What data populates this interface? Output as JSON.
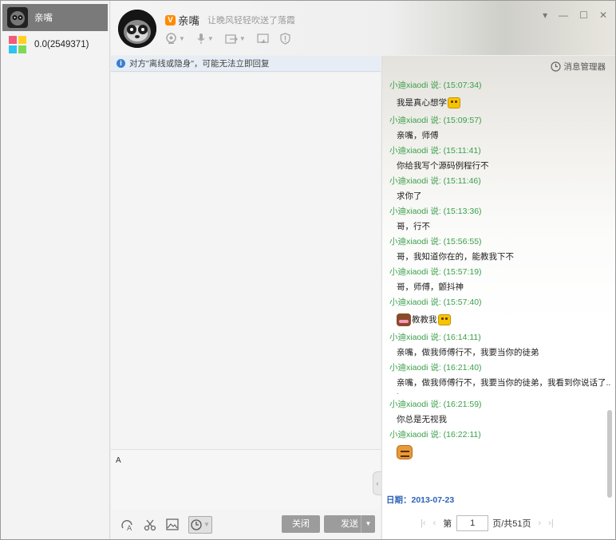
{
  "contacts": [
    {
      "name": "亲嘴",
      "active": true
    },
    {
      "name": "0.0(2549371)",
      "active": false
    }
  ],
  "header": {
    "vip_badge": "V",
    "nickname": "亲嘴",
    "signature": "让晚风轻轻吹送了落霞",
    "toolbar_icons": [
      "video-call-icon",
      "voice-call-icon",
      "file-transfer-icon",
      "remote-assist-icon",
      "shield-icon"
    ]
  },
  "window_controls": [
    "minimize-icon",
    "maximize-icon",
    "close-icon"
  ],
  "notice": {
    "text": "对方\"离线或隐身\"，可能无法立即回复"
  },
  "input": {
    "value": "A"
  },
  "bottom": {
    "close_label": "关闭",
    "send_label": "发送",
    "tool_icons": [
      "font-icon",
      "screenshot-scissors-icon",
      "image-icon",
      "history-clock-icon"
    ]
  },
  "history": {
    "manager_label": "消息管理器",
    "messages": [
      {
        "meta": "小迪xiaodi 说: (15:07:34)",
        "text": "我是真心想学",
        "emoji_after": true
      },
      {
        "meta": "小迪xiaodi 说: (15:09:57)",
        "text": "亲嘴，师傅"
      },
      {
        "meta": "小迪xiaodi 说: (15:11:41)",
        "text": "你给我写个源码例程行不"
      },
      {
        "meta": "小迪xiaodi 说: (15:11:46)",
        "text": "求你了"
      },
      {
        "meta": "小迪xiaodi 说: (15:13:36)",
        "text": "哥，行不"
      },
      {
        "meta": "小迪xiaodi 说: (15:56:55)",
        "text": "哥，我知道你在的，能教我下不"
      },
      {
        "meta": "小迪xiaodi 说: (15:57:19)",
        "text": "哥，师傅，颤抖神"
      },
      {
        "meta": "小迪xiaodi 说: (15:57:40)",
        "text": "教教我",
        "emoji_before": true,
        "emoji_after": true
      },
      {
        "meta": "小迪xiaodi 说: (16:14:11)",
        "text": "亲嘴，做我师傅行不，我要当你的徒弟"
      },
      {
        "meta": "小迪xiaodi 说: (16:21:40)",
        "text": "亲嘴，做我师傅行不，我要当你的徒弟，我看到你说话了..",
        "trailing_dot": true
      },
      {
        "meta": "小迪xiaodi 说: (16:21:59)",
        "text": "你总是无视我"
      },
      {
        "meta": "小迪xiaodi 说: (16:22:11)",
        "text": "",
        "emoji_only": true
      }
    ],
    "date_label": "日期：2013-07-23",
    "pager": {
      "prefix": "第",
      "page": "1",
      "suffix": "页/共51页"
    }
  }
}
